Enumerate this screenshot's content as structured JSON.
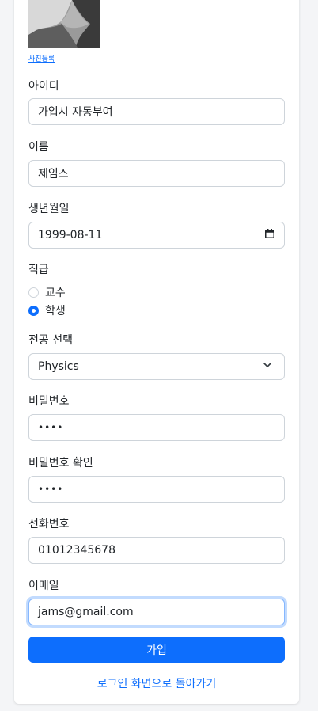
{
  "photo": {
    "alt": "profile photo",
    "link_label": "사진등록"
  },
  "fields": {
    "id": {
      "label": "아이디",
      "value": "가입시 자동부여"
    },
    "name": {
      "label": "이름",
      "value": "제임스"
    },
    "birth": {
      "label": "생년월일",
      "value": "1999-08-11"
    },
    "position": {
      "label": "직급",
      "options": [
        {
          "label": "교수",
          "checked": false
        },
        {
          "label": "학생",
          "checked": true
        }
      ]
    },
    "major": {
      "label": "전공 선택",
      "value": "Physics"
    },
    "password": {
      "label": "비밀번호",
      "value": "••••"
    },
    "password_confirm": {
      "label": "비밀번호 확인",
      "value": "••••"
    },
    "phone": {
      "label": "전화번호",
      "value": "01012345678"
    },
    "email": {
      "label": "이메일",
      "value": "jams@gmail.com"
    }
  },
  "submit_label": "가입",
  "back_link": "로그인 화면으로 돌아가기",
  "colors": {
    "accent": "#0d6efd",
    "border": "#ced4da",
    "focus_border": "#86b7fe"
  },
  "icons": {
    "birth": "calendar-icon",
    "major": "chevron-down-icon"
  }
}
